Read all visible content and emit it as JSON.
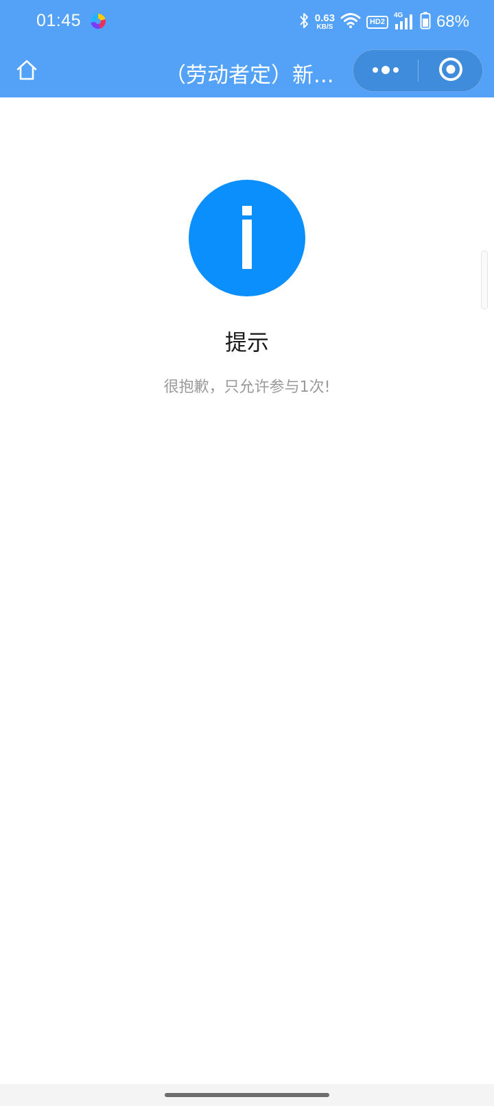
{
  "status_bar": {
    "time": "01:45",
    "net_speed_value": "0.63",
    "net_speed_unit": "KB/S",
    "hd_label": "HD2",
    "network_type": "4G",
    "battery_percent": "68%",
    "icons": [
      "app-icon",
      "bluetooth-icon",
      "wifi-icon",
      "signal-icon",
      "battery-icon"
    ]
  },
  "nav_bar": {
    "title": "（劳动者定）新...",
    "icons": [
      "home-icon",
      "more-icon",
      "close-target-icon"
    ],
    "background_color": "#54a2f7"
  },
  "content": {
    "icon": "info-icon",
    "icon_color": "#0b8ffd",
    "title": "提示",
    "message": "很抱歉，只允许参与1次!"
  }
}
